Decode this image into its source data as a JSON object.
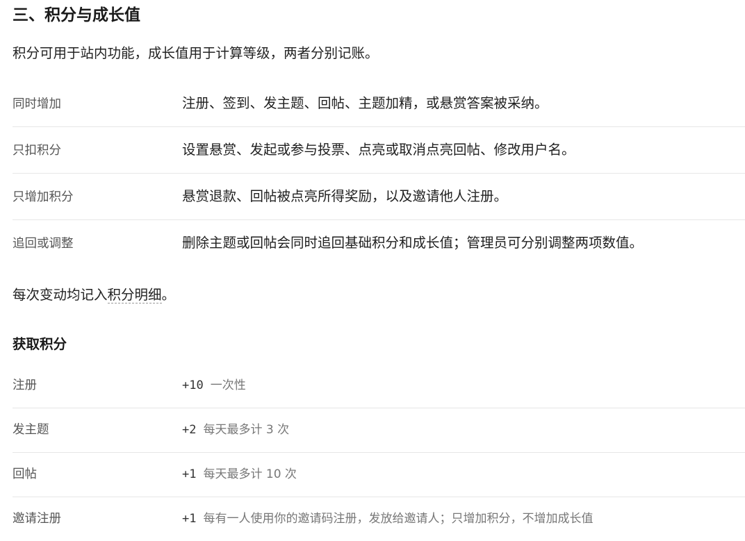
{
  "section": {
    "title": "三、积分与成长值",
    "intro": "积分可用于站内功能，成长值用于计算等级，两者分别记账。"
  },
  "rules": [
    {
      "label": "同时增加",
      "text": "注册、签到、发主题、回帖、主题加精，或悬赏答案被采纳。"
    },
    {
      "label": "只扣积分",
      "text": "设置悬赏、发起或参与投票、点亮或取消点亮回帖、修改用户名。"
    },
    {
      "label": "只增加积分",
      "text": "悬赏退款、回帖被点亮所得奖励，以及邀请他人注册。"
    },
    {
      "label": "追回或调整",
      "text": "删除主题或回帖会同时追回基础积分和成长值；管理员可分别调整两项数值。"
    }
  ],
  "note": {
    "prefix": "每次变动均记入",
    "link": "积分明细",
    "suffix": "。"
  },
  "earn": {
    "title": "获取积分",
    "items": [
      {
        "label": "注册",
        "points": "+10",
        "note": "一次性"
      },
      {
        "label": "发主题",
        "points": "+2",
        "note": "每天最多计 3 次"
      },
      {
        "label": "回帖",
        "points": "+1",
        "note": "每天最多计 10 次"
      },
      {
        "label": "邀请注册",
        "points": "+1",
        "note": "每有一人使用你的邀请码注册，发放给邀请人；只增加积分，不增加成长值"
      }
    ]
  }
}
